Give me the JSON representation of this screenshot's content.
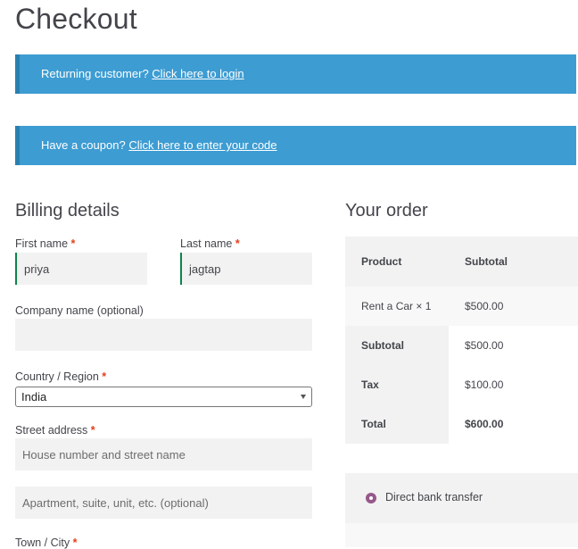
{
  "page": {
    "title": "Checkout"
  },
  "notices": {
    "returning": {
      "text": "Returning customer?",
      "link": "Click here to login"
    },
    "coupon": {
      "text": "Have a coupon?",
      "link": "Click here to enter your code"
    }
  },
  "billing": {
    "heading": "Billing details",
    "required_mark": "*",
    "first_name": {
      "label": "First name",
      "value": "priya"
    },
    "last_name": {
      "label": "Last name",
      "value": "jagtap"
    },
    "company": {
      "label": "Company name (optional)",
      "value": ""
    },
    "country": {
      "label": "Country / Region",
      "selected": "India"
    },
    "street": {
      "label": "Street address",
      "placeholder1": "House number and street name",
      "placeholder2": "Apartment, suite, unit, etc. (optional)"
    },
    "town": {
      "label": "Town / City"
    }
  },
  "order": {
    "heading": "Your order",
    "headers": {
      "product": "Product",
      "subtotal": "Subtotal"
    },
    "item": {
      "name": "Rent a Car",
      "qty": "× 1",
      "price": "$500.00"
    },
    "subtotal": {
      "label": "Subtotal",
      "value": "$500.00"
    },
    "tax": {
      "label": "Tax",
      "value": "$100.00"
    },
    "total": {
      "label": "Total",
      "value": "$600.00"
    }
  },
  "payment": {
    "method": "Direct bank transfer"
  },
  "colors": {
    "accent": "#3d9cd2",
    "radio": "#96588a",
    "required": "#e2401c"
  }
}
